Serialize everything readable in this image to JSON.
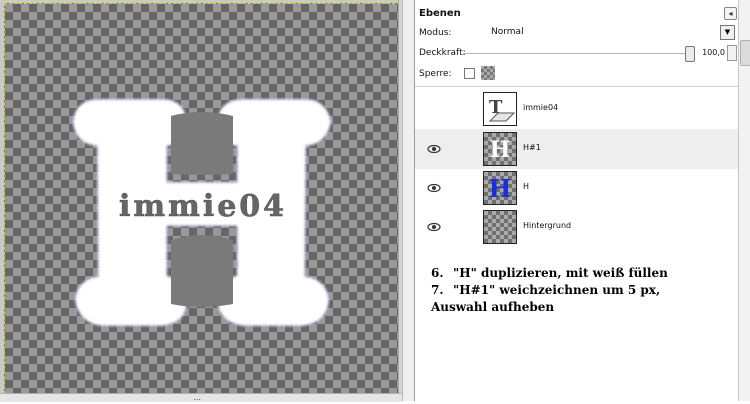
{
  "canvas": {
    "image_text": "immie04",
    "letter": "H"
  },
  "layers_dock": {
    "title": "Ebenen",
    "mode_label": "Modus:",
    "mode_value": "Normal",
    "opacity_label": "Deckkraft:",
    "opacity_value": "100,0",
    "lock_label": "Sperre:",
    "layers": [
      {
        "name": "immie04",
        "type": "text",
        "visible": false
      },
      {
        "name": "H#1",
        "type": "white-h",
        "visible": true,
        "active": true
      },
      {
        "name": "H",
        "type": "blue-h",
        "visible": true
      },
      {
        "name": "Hintergrund",
        "type": "background",
        "visible": true
      }
    ]
  },
  "instructions": [
    {
      "num": "6.",
      "text": "\"H\" duplizieren, mit weiß füllen"
    },
    {
      "num": "7.",
      "text": "\"H#1\" weichzeichnen um 5 px,"
    },
    {
      "num": "",
      "text": "Auswahl aufheben"
    }
  ],
  "colors": {
    "accent_blue": "#1a2fd6",
    "checker_dark": "#666666",
    "checker_light": "#999999"
  }
}
